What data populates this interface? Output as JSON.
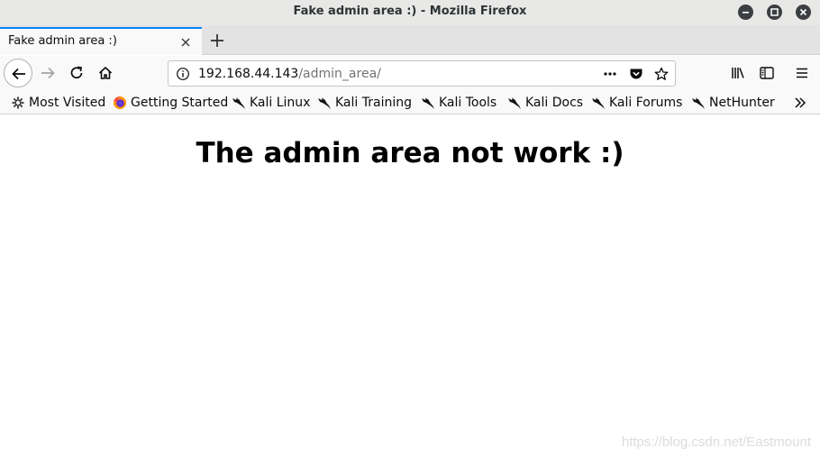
{
  "window": {
    "title": "Fake admin area :) - Mozilla Firefox"
  },
  "tabs": [
    {
      "label": "Fake admin area :)",
      "active": true
    }
  ],
  "navbar": {
    "url_host": "192.168.44.143",
    "url_path": "/admin_area/"
  },
  "bookmarks": [
    {
      "label": "Most Visited",
      "icon": "gear-icon"
    },
    {
      "label": "Getting Started",
      "icon": "firefox-icon"
    },
    {
      "label": "Kali Linux",
      "icon": "kali-dragon-icon"
    },
    {
      "label": "Kali Training",
      "icon": "kali-dragon-icon"
    },
    {
      "label": "Kali Tools",
      "icon": "kali-dragon-icon"
    },
    {
      "label": "Kali Docs",
      "icon": "kali-dragon-icon"
    },
    {
      "label": "Kali Forums",
      "icon": "kali-dragon-icon"
    },
    {
      "label": "NetHunter",
      "icon": "kali-dragon-icon"
    }
  ],
  "page": {
    "heading": "The admin area not work :)",
    "watermark": "https://blog.csdn.net/Eastmount"
  },
  "colors": {
    "tab_accent": "#0a84ff",
    "titlebar_bg": "#e8e8e7",
    "toolbar_bg": "#f9f9fa"
  }
}
